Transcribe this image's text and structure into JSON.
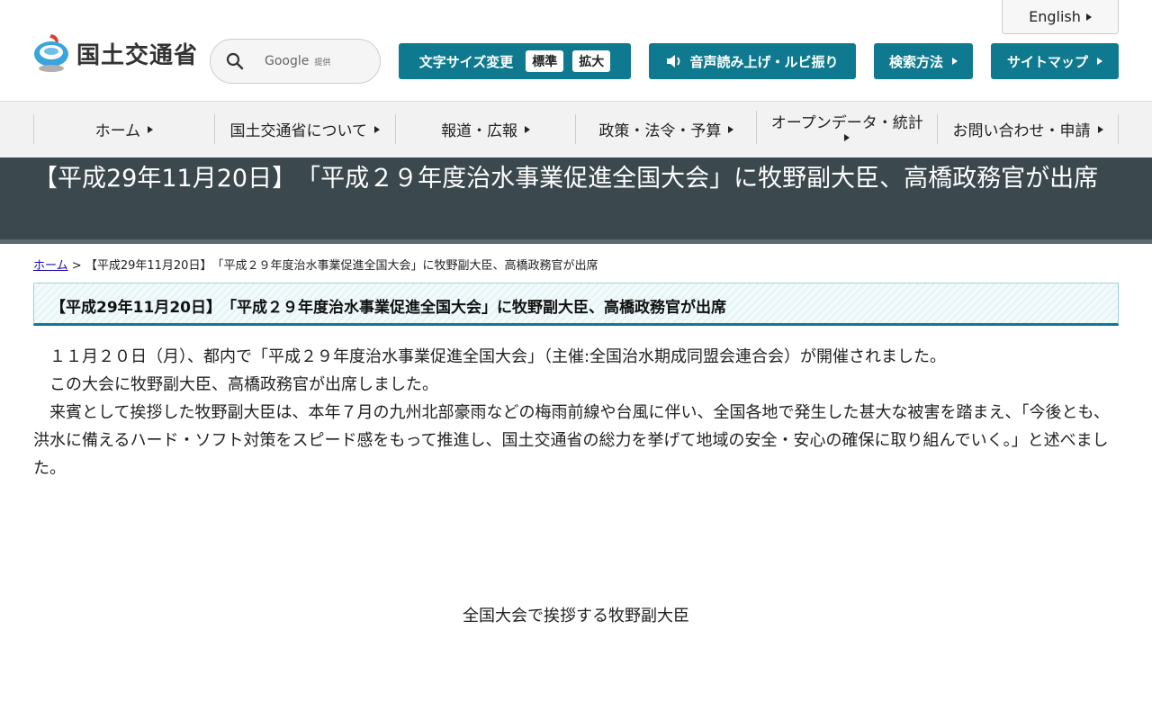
{
  "header": {
    "english_label": "English",
    "logo_text": "国土交通省",
    "search": {
      "google_label": "Google",
      "google_sub": "提供"
    },
    "font_size": {
      "label": "文字サイズ変更",
      "standard": "標準",
      "large": "拡大"
    },
    "voice_label": "音声読み上げ・ルビ振り",
    "search_method_label": "検索方法",
    "sitemap_label": "サイトマップ"
  },
  "nav": {
    "items": [
      {
        "label": "ホーム"
      },
      {
        "label": "国土交通省について"
      },
      {
        "label": "報道・広報"
      },
      {
        "label": "政策・法令・予算"
      },
      {
        "label": "オープンデータ・統計"
      },
      {
        "label": "お問い合わせ・申請"
      }
    ]
  },
  "page": {
    "title": "【平成29年11月20日】　「平成２９年度治水事業促進全国大会」に牧野副大臣、高橋政務官が出席",
    "breadcrumb_home": "ホーム",
    "breadcrumb_sep": ">",
    "breadcrumb_current": "【平成29年11月20日】　「平成２９年度治水事業促進全国大会」に牧野副大臣、高橋政務官が出席",
    "subheading": "【平成29年11月20日】　「平成２９年度治水事業促進全国大会」に牧野副大臣、高橋政務官が出席",
    "paragraphs": [
      "　１１月２０日（月）、都内で「平成２９年度治水事業促進全国大会」（主催:全国治水期成同盟会連合会）が開催されました。",
      "　この大会に牧野副大臣、高橋政務官が出席しました。",
      "　来賓として挨拶した牧野副大臣は、本年７月の九州北部豪雨などの梅雨前線や台風に伴い、全国各地で発生した甚大な被害を踏まえ、「今後とも、洪水に備えるハード・ソフト対策をスピード感をもって推進し、国土交通省の総力を挙げて地域の安全・安心の確保に取り組んでいく。」と述べました。"
    ],
    "caption": "全国大会で挨拶する牧野副大臣"
  },
  "colors": {
    "accent": "#0f7a8f",
    "titlebar": "#3b484e"
  }
}
